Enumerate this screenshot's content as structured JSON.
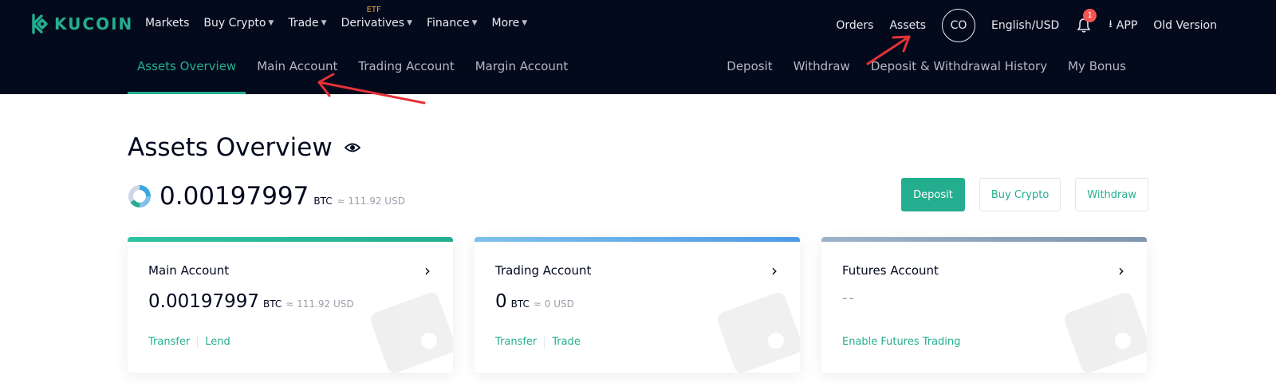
{
  "brand": {
    "name": "KUCOIN"
  },
  "colors": {
    "accent": "#24ae8f",
    "header_bg": "#030a1c",
    "badge": "#f65454",
    "etf_tag": "#e6a243",
    "annotation": "#e53238"
  },
  "nav": {
    "main": [
      {
        "label": "Markets",
        "chevron": false
      },
      {
        "label": "Buy Crypto",
        "chevron": true
      },
      {
        "label": "Trade",
        "chevron": true
      },
      {
        "label": "Derivatives",
        "chevron": true,
        "tag": "ETF"
      },
      {
        "label": "Finance",
        "chevron": true
      },
      {
        "label": "More",
        "chevron": true
      }
    ],
    "right": {
      "orders": "Orders",
      "assets": "Assets",
      "avatar": "CO",
      "language": "English/USD",
      "notification_count": "1",
      "app": "APP",
      "old_version": "Old Version"
    }
  },
  "subnav": {
    "left": [
      "Assets Overview",
      "Main Account",
      "Trading Account",
      "Margin Account"
    ],
    "right": [
      "Deposit",
      "Withdraw",
      "Deposit & Withdrawal History",
      "My Bonus"
    ]
  },
  "overview": {
    "title": "Assets Overview",
    "balance": "0.00197997",
    "unit": "BTC",
    "usd": "≈ 111.92 USD"
  },
  "actions": {
    "deposit": "Deposit",
    "buy_crypto": "Buy Crypto",
    "withdraw": "Withdraw"
  },
  "cards": [
    {
      "title": "Main Account",
      "value": "0.00197997",
      "unit": "BTC",
      "usd": "≈ 111.92 USD",
      "links": [
        "Transfer",
        "Lend"
      ],
      "color_from": "#2fc3a0",
      "color_to": "#24ae8f"
    },
    {
      "title": "Trading Account",
      "value": "0",
      "unit": "BTC",
      "usd": "≈ 0 USD",
      "links": [
        "Transfer",
        "Trade"
      ],
      "color_from": "#7fc1ea",
      "color_to": "#4d9ae8"
    },
    {
      "title": "Futures Account",
      "empty": "--",
      "links": [
        "Enable Futures Trading"
      ],
      "color_from": "#9db3c9",
      "color_to": "#7f95ad"
    }
  ]
}
